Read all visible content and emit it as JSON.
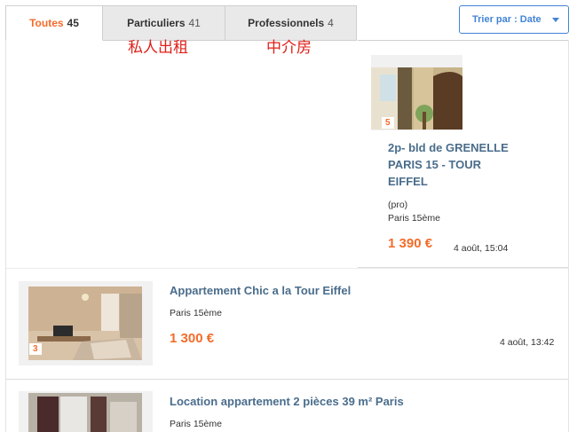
{
  "tabs": [
    {
      "label": "Toutes",
      "count": "45"
    },
    {
      "label": "Particuliers",
      "count": "41"
    },
    {
      "label": "Professionnels",
      "count": "4"
    }
  ],
  "annotations": {
    "particuliers": "私人出租",
    "professionnels": "中介房"
  },
  "sort": {
    "label": "Trier par : Date"
  },
  "listings": [
    {
      "title_lines": [
        "2p- bld de GRENELLE",
        "PARIS 15 - TOUR",
        "EIFFEL"
      ],
      "tag": "(pro)",
      "location": "Paris 15ème",
      "price": "1 390 €",
      "date": "4 août, 15:04",
      "photo_count": "5"
    },
    {
      "title": "Appartement Chic a la Tour Eiffel",
      "location": "Paris 15ème",
      "price": "1 300 €",
      "date": "4 août, 13:42",
      "photo_count": "3"
    },
    {
      "title": "Location appartement 2 pièces 39 m² Paris",
      "location": "Paris 15ème"
    }
  ],
  "colors": {
    "accent": "#f56b2a",
    "link": "#4a6d8c",
    "sort_blue": "#4183d7"
  }
}
